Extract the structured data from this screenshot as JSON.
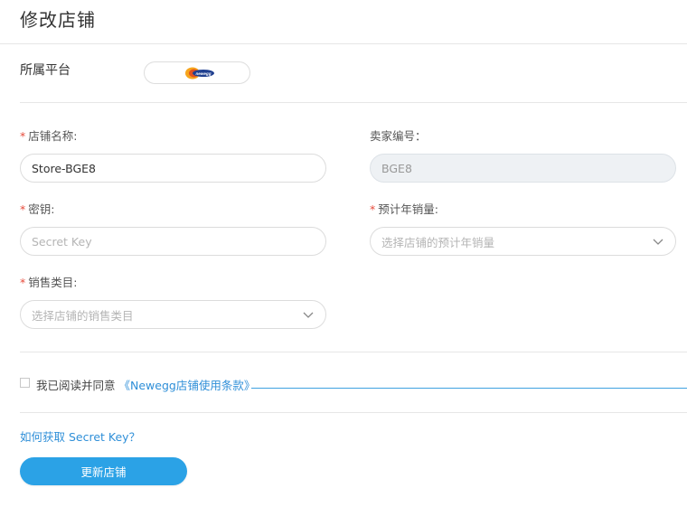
{
  "page": {
    "title": "修改店铺"
  },
  "platform": {
    "label": "所属平台",
    "logo_text": "newegg"
  },
  "form": {
    "required_mark": "*",
    "store_name": {
      "label": "店铺名称:",
      "value": "Store-BGE8"
    },
    "seller_id": {
      "label": "卖家编号：",
      "value": "BGE8"
    },
    "secret_key": {
      "label": "密钥:",
      "placeholder": "Secret Key"
    },
    "annual_sales": {
      "label": "预计年销量:",
      "placeholder": "选择店铺的预计年销量"
    },
    "sales_category": {
      "label": "销售类目:",
      "placeholder": "选择店铺的销售类目"
    }
  },
  "agreement": {
    "text": "我已阅读并同意",
    "link": "《Newegg店铺使用条款》",
    "checked": false
  },
  "help": {
    "link": "如何获取 Secret Key？"
  },
  "submit": {
    "label": "更新店铺"
  },
  "colors": {
    "accent": "#2ba2e6",
    "link": "#2f8fd8",
    "required": "#e74c3c"
  }
}
